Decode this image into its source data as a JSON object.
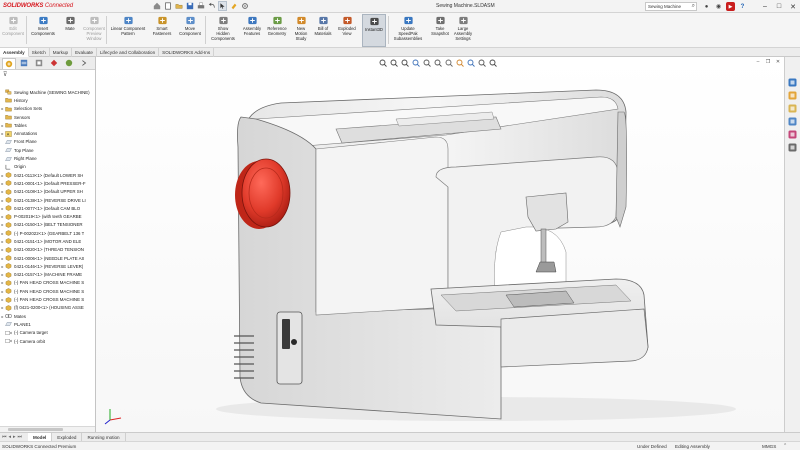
{
  "app": {
    "logo_brand": "SOLIDWORKS",
    "logo_suffix": "Connected",
    "document_title": "Sewing Machine.SLDASM",
    "search_value": "Sewing Machine",
    "accent_color": "#d71920"
  },
  "quick_access": [
    "home-icon",
    "new-icon",
    "open-icon",
    "save-icon",
    "print-icon",
    "undo-icon",
    "select-icon",
    "rebuild-icon",
    "options-icon"
  ],
  "ribbon": {
    "buttons": [
      {
        "label": "Edit\nComponent",
        "icon": "edit-component-icon",
        "dim": true
      },
      {
        "label": "Insert\nComponents",
        "icon": "insert-components-icon",
        "dim": false
      },
      {
        "label": "Mate",
        "icon": "mate-icon",
        "dim": false
      },
      {
        "label": "Component\nPreview\nWindow",
        "icon": "component-preview-icon",
        "dim": true
      },
      {
        "label": "Linear Component\nPattern",
        "icon": "linear-pattern-icon",
        "dim": false
      },
      {
        "label": "Smart\nFasteners",
        "icon": "smart-fasteners-icon",
        "dim": false
      },
      {
        "label": "Move\nComponent",
        "icon": "move-component-icon",
        "dim": false
      },
      {
        "label": "Show\nHidden\nComponents",
        "icon": "show-hidden-icon",
        "dim": false
      },
      {
        "label": "Assembly\nFeatures",
        "icon": "assembly-features-icon",
        "dim": false
      },
      {
        "label": "Reference\nGeometry",
        "icon": "reference-geometry-icon",
        "dim": false
      },
      {
        "label": "New\nMotion\nStudy",
        "icon": "motion-study-icon",
        "dim": false
      },
      {
        "label": "Bill of\nMaterials",
        "icon": "bom-icon",
        "dim": false
      },
      {
        "label": "Exploded\nView",
        "icon": "exploded-view-icon",
        "dim": false
      },
      {
        "label": "Instant3D",
        "icon": "instant3d-icon",
        "dim": false
      },
      {
        "label": "Update\nSpeedPak\nSubassemblies",
        "icon": "speedpak-icon",
        "dim": false
      },
      {
        "label": "Take\nSnapshot",
        "icon": "snapshot-icon",
        "dim": false
      },
      {
        "label": "Large\nAssembly\nSettings",
        "icon": "large-assembly-icon",
        "dim": false
      }
    ]
  },
  "command_tabs": [
    "Assembly",
    "Sketch",
    "Markup",
    "Evaluate",
    "Lifecycle and Collaboration",
    "SOLIDWORKS Add-Ins"
  ],
  "tree": {
    "items": [
      {
        "label": "Sewing Machine (SEWING MACHINE)",
        "expander": "",
        "icon": "assembly"
      },
      {
        "label": "History",
        "expander": "",
        "icon": "folder"
      },
      {
        "label": "Selection Sets",
        "expander": "▸",
        "icon": "folder"
      },
      {
        "label": "Sensors",
        "expander": "",
        "icon": "folder"
      },
      {
        "label": "Tables",
        "expander": "▸",
        "icon": "folder"
      },
      {
        "label": "Annotations",
        "expander": "▸",
        "icon": "annotation"
      },
      {
        "label": "Front Plane",
        "expander": "",
        "icon": "plane"
      },
      {
        "label": "Top Plane",
        "expander": "",
        "icon": "plane"
      },
      {
        "label": "Right Plane",
        "expander": "",
        "icon": "plane"
      },
      {
        "label": "Origin",
        "expander": "",
        "icon": "origin"
      },
      {
        "label": "0421-0113<1> (Default LOWER SH",
        "expander": "▸",
        "icon": "part"
      },
      {
        "label": "0421-0001<1> (Default PRESSER-F",
        "expander": "▸",
        "icon": "part"
      },
      {
        "label": "0421-0108<1> (Default UPPER SH",
        "expander": "▸",
        "icon": "part"
      },
      {
        "label": "0421-0138<1> (REVERSE DRIVE LI",
        "expander": "▸",
        "icon": "part"
      },
      {
        "label": "0421-0077<1> (Default CAM BLO",
        "expander": "▸",
        "icon": "part"
      },
      {
        "label": "P-002019<1> (with teeth GEARBE",
        "expander": "▸",
        "icon": "part"
      },
      {
        "label": "0421-0150<1> (BELT TENSIONER",
        "expander": "▸",
        "icon": "part"
      },
      {
        "label": "(-) P-002022<1> (GEARBELT 136 T",
        "expander": "▸",
        "icon": "part"
      },
      {
        "label": "0421-0151<1> (MOTOR AND ELE",
        "expander": "▸",
        "icon": "part"
      },
      {
        "label": "0421-0020<1> (THREAD TENSION",
        "expander": "▸",
        "icon": "part"
      },
      {
        "label": "0421-0006<1> (NEEDLE PLATE AS",
        "expander": "▸",
        "icon": "part"
      },
      {
        "label": "0421-0146<1> (REVERSE LEVER)",
        "expander": "▸",
        "icon": "part"
      },
      {
        "label": "0421-0157<1> (MACHINE FRAME",
        "expander": "▸",
        "icon": "part"
      },
      {
        "label": "(-) PAN HEAD CROSS MACHINE S",
        "expander": "▸",
        "icon": "part"
      },
      {
        "label": "(-) PAN HEAD CROSS MACHINE S",
        "expander": "▸",
        "icon": "part"
      },
      {
        "label": "(-) PAN HEAD CROSS MACHINE S",
        "expander": "▸",
        "icon": "part"
      },
      {
        "label": "(f) 0421-0200<1> (HOUSING ASSE",
        "expander": "▸",
        "icon": "part"
      },
      {
        "label": "Mates",
        "expander": "▸",
        "icon": "mates"
      },
      {
        "label": "PLANE1",
        "expander": "",
        "icon": "plane"
      },
      {
        "label": "(-) Camera target",
        "expander": "",
        "icon": "camera"
      },
      {
        "label": "(-) Camera orbit",
        "expander": "",
        "icon": "camera"
      }
    ]
  },
  "heads_up_toolbar": [
    "zoom-to-fit-icon",
    "zoom-area-icon",
    "previous-view-icon",
    "section-view-icon",
    "view-orientation-icon",
    "display-style-icon",
    "hide-show-icon",
    "edit-appearance-icon",
    "scene-icon",
    "view-settings-icon",
    "monitor-icon"
  ],
  "task_pane": [
    "solidworks-resources-icon",
    "design-library-icon",
    "file-explorer-icon",
    "view-palette-icon",
    "appearances-icon",
    "custom-properties-icon"
  ],
  "bottom_tabs": [
    "Model",
    "Exploded",
    "Running motion"
  ],
  "status": {
    "left": "SOLIDWORKS Connected Premium",
    "definition": "Under Defined",
    "mode": "Editing Assembly",
    "units": "MMGS"
  }
}
